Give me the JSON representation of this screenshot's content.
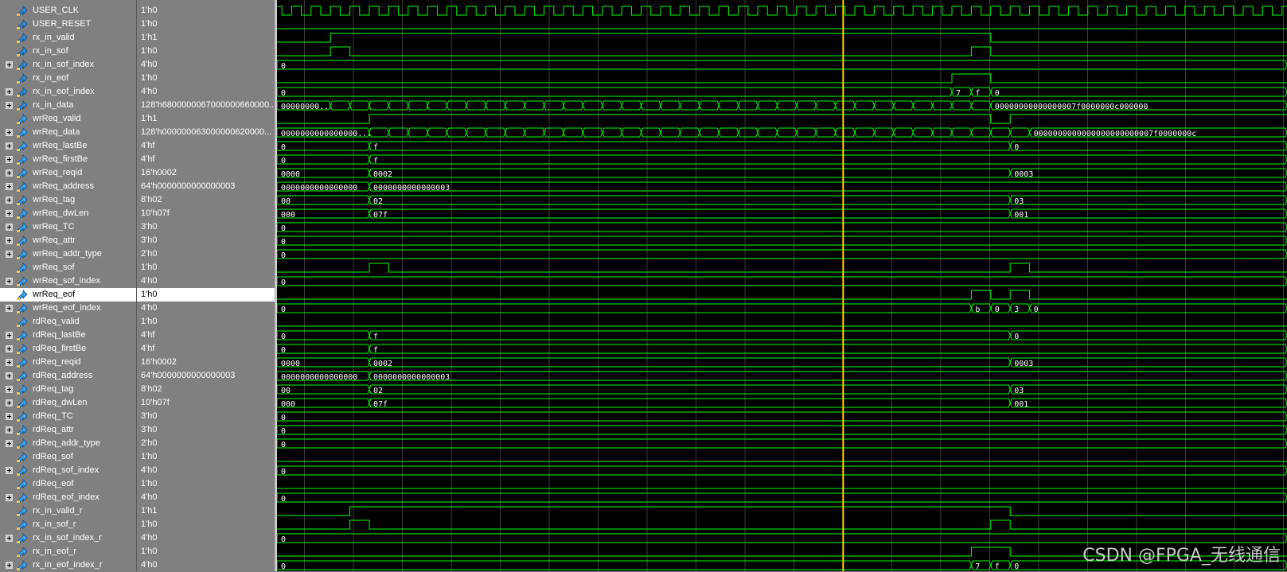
{
  "signals": [
    {
      "name": "USER_CLK",
      "value": "1'h0",
      "bus": false,
      "icon": "input-arrow-icon"
    },
    {
      "name": "USER_RESET",
      "value": "1'h0",
      "bus": false,
      "icon": "input-arrow-icon"
    },
    {
      "name": "rx_in_valid",
      "value": "1'h1",
      "bus": false,
      "icon": "input-arrow-icon"
    },
    {
      "name": "rx_in_sof",
      "value": "1'h0",
      "bus": false,
      "icon": "input-arrow-icon"
    },
    {
      "name": "rx_in_sof_index",
      "value": "4'h0",
      "bus": true,
      "icon": "input-arrow-icon"
    },
    {
      "name": "rx_in_eof",
      "value": "1'h0",
      "bus": false,
      "icon": "input-arrow-icon"
    },
    {
      "name": "rx_in_eof_index",
      "value": "4'h0",
      "bus": true,
      "icon": "input-arrow-icon"
    },
    {
      "name": "rx_in_data",
      "value": "128'h6800000067000000660000...",
      "bus": true,
      "icon": "input-arrow-icon"
    },
    {
      "name": "wrReq_valid",
      "value": "1'h1",
      "bus": false,
      "icon": "output-arrow-icon"
    },
    {
      "name": "wrReq_data",
      "value": "128'h000000063000000620000...",
      "bus": true,
      "icon": "output-arrow-icon"
    },
    {
      "name": "wrReq_lastBe",
      "value": "4'hf",
      "bus": true,
      "icon": "output-arrow-icon"
    },
    {
      "name": "wrReq_firstBe",
      "value": "4'hf",
      "bus": true,
      "icon": "output-arrow-icon"
    },
    {
      "name": "wrReq_reqid",
      "value": "16'h0002",
      "bus": true,
      "icon": "output-arrow-icon"
    },
    {
      "name": "wrReq_address",
      "value": "64'h0000000000000003",
      "bus": true,
      "icon": "output-arrow-icon"
    },
    {
      "name": "wrReq_tag",
      "value": "8'h02",
      "bus": true,
      "icon": "output-arrow-icon"
    },
    {
      "name": "wrReq_dwLen",
      "value": "10'h07f",
      "bus": true,
      "icon": "output-arrow-icon"
    },
    {
      "name": "wrReq_TC",
      "value": "3'h0",
      "bus": true,
      "icon": "output-arrow-icon"
    },
    {
      "name": "wrReq_attr",
      "value": "3'h0",
      "bus": true,
      "icon": "output-arrow-icon"
    },
    {
      "name": "wrReq_addr_type",
      "value": "2'h0",
      "bus": true,
      "icon": "output-arrow-icon"
    },
    {
      "name": "wrReq_sof",
      "value": "1'h0",
      "bus": false,
      "icon": "output-arrow-icon"
    },
    {
      "name": "wrReq_sof_index",
      "value": "4'h0",
      "bus": true,
      "icon": "output-arrow-icon"
    },
    {
      "name": "wrReq_eof",
      "value": "1'h0",
      "bus": false,
      "icon": "output-arrow-icon",
      "selected": true
    },
    {
      "name": "wrReq_eof_index",
      "value": "4'h0",
      "bus": true,
      "icon": "output-arrow-icon"
    },
    {
      "name": "rdReq_valid",
      "value": "1'h0",
      "bus": false,
      "icon": "output-arrow-icon"
    },
    {
      "name": "rdReq_lastBe",
      "value": "4'hf",
      "bus": true,
      "icon": "output-arrow-icon"
    },
    {
      "name": "rdReq_firstBe",
      "value": "4'hf",
      "bus": true,
      "icon": "output-arrow-icon"
    },
    {
      "name": "rdReq_reqid",
      "value": "16'h0002",
      "bus": true,
      "icon": "output-arrow-icon"
    },
    {
      "name": "rdReq_address",
      "value": "64'h0000000000000003",
      "bus": true,
      "icon": "output-arrow-icon"
    },
    {
      "name": "rdReq_tag",
      "value": "8'h02",
      "bus": true,
      "icon": "output-arrow-icon"
    },
    {
      "name": "rdReq_dwLen",
      "value": "10'h07f",
      "bus": true,
      "icon": "output-arrow-icon"
    },
    {
      "name": "rdReq_TC",
      "value": "3'h0",
      "bus": true,
      "icon": "output-arrow-icon"
    },
    {
      "name": "rdReq_attr",
      "value": "3'h0",
      "bus": true,
      "icon": "output-arrow-icon"
    },
    {
      "name": "rdReq_addr_type",
      "value": "2'h0",
      "bus": true,
      "icon": "output-arrow-icon"
    },
    {
      "name": "rdReq_sof",
      "value": "1'h0",
      "bus": false,
      "icon": "output-arrow-icon"
    },
    {
      "name": "rdReq_sof_index",
      "value": "4'h0",
      "bus": true,
      "icon": "output-arrow-icon"
    },
    {
      "name": "rdReq_eof",
      "value": "1'h0",
      "bus": false,
      "icon": "output-arrow-icon"
    },
    {
      "name": "rdReq_eof_index",
      "value": "4'h0",
      "bus": true,
      "icon": "output-arrow-icon"
    },
    {
      "name": "rx_in_valid_r",
      "value": "1'h1",
      "bus": false,
      "icon": "output-arrow-icon"
    },
    {
      "name": "rx_in_sof_r",
      "value": "1'h0",
      "bus": false,
      "icon": "output-arrow-icon"
    },
    {
      "name": "rx_in_sof_index_r",
      "value": "4'h0",
      "bus": true,
      "icon": "output-arrow-icon"
    },
    {
      "name": "rx_in_eof_r",
      "value": "1'h0",
      "bus": false,
      "icon": "output-arrow-icon"
    },
    {
      "name": "rx_in_eof_index_r",
      "value": "4'h0",
      "bus": true,
      "icon": "output-arrow-icon"
    }
  ],
  "waves": {
    "time_units": "clock cycles",
    "cursor_cycle": 29.4,
    "rows": [
      {
        "kind": "clock"
      },
      {
        "kind": "bit",
        "init": 0,
        "edges": []
      },
      {
        "kind": "bit",
        "init": 0,
        "edges": [
          3,
          37
        ]
      },
      {
        "kind": "bit",
        "init": 0,
        "edges": [
          3,
          4,
          36,
          37
        ]
      },
      {
        "kind": "bus",
        "segments": [
          [
            0,
            "0"
          ]
        ]
      },
      {
        "kind": "bit",
        "init": 0,
        "edges": [
          35,
          37
        ]
      },
      {
        "kind": "bus",
        "segments": [
          [
            0,
            "0"
          ],
          [
            35,
            "7"
          ],
          [
            36,
            "f"
          ],
          [
            37,
            "0"
          ]
        ]
      },
      {
        "kind": "bus",
        "segments": [
          [
            0,
            "00000000..."
          ],
          [
            3,
            ""
          ],
          [
            4,
            ""
          ],
          [
            5,
            ""
          ],
          [
            6,
            ""
          ],
          [
            7,
            ""
          ],
          [
            8,
            ""
          ],
          [
            9,
            ""
          ],
          [
            10,
            ""
          ],
          [
            11,
            ""
          ],
          [
            12,
            ""
          ],
          [
            13,
            ""
          ],
          [
            14,
            ""
          ],
          [
            15,
            ""
          ],
          [
            16,
            ""
          ],
          [
            17,
            ""
          ],
          [
            18,
            ""
          ],
          [
            19,
            ""
          ],
          [
            20,
            ""
          ],
          [
            21,
            ""
          ],
          [
            22,
            ""
          ],
          [
            23,
            ""
          ],
          [
            24,
            ""
          ],
          [
            25,
            ""
          ],
          [
            26,
            ""
          ],
          [
            27,
            ""
          ],
          [
            28,
            ""
          ],
          [
            29,
            ""
          ],
          [
            30,
            ""
          ],
          [
            31,
            ""
          ],
          [
            32,
            ""
          ],
          [
            33,
            ""
          ],
          [
            34,
            ""
          ],
          [
            35,
            ""
          ],
          [
            36,
            ""
          ],
          [
            37,
            "00000000000000007f0000000c000000"
          ]
        ]
      },
      {
        "kind": "bit",
        "init": 0,
        "edges": [
          5,
          37,
          38
        ]
      },
      {
        "kind": "bus",
        "segments": [
          [
            0,
            "0000000000000000..."
          ],
          [
            5,
            ""
          ],
          [
            6,
            ""
          ],
          [
            7,
            ""
          ],
          [
            8,
            ""
          ],
          [
            9,
            ""
          ],
          [
            10,
            ""
          ],
          [
            11,
            ""
          ],
          [
            12,
            ""
          ],
          [
            13,
            ""
          ],
          [
            14,
            ""
          ],
          [
            15,
            ""
          ],
          [
            16,
            ""
          ],
          [
            17,
            ""
          ],
          [
            18,
            ""
          ],
          [
            19,
            ""
          ],
          [
            20,
            ""
          ],
          [
            21,
            ""
          ],
          [
            22,
            ""
          ],
          [
            23,
            ""
          ],
          [
            24,
            ""
          ],
          [
            25,
            ""
          ],
          [
            26,
            ""
          ],
          [
            27,
            ""
          ],
          [
            28,
            ""
          ],
          [
            29,
            ""
          ],
          [
            30,
            ""
          ],
          [
            31,
            ""
          ],
          [
            32,
            ""
          ],
          [
            33,
            ""
          ],
          [
            34,
            ""
          ],
          [
            35,
            ""
          ],
          [
            36,
            ""
          ],
          [
            37,
            ""
          ],
          [
            38,
            ""
          ],
          [
            39,
            "0000000000000000000000007f0000000c"
          ]
        ]
      },
      {
        "kind": "bus",
        "segments": [
          [
            0,
            "0"
          ],
          [
            5,
            "f"
          ],
          [
            38,
            "0"
          ]
        ]
      },
      {
        "kind": "bus",
        "segments": [
          [
            0,
            "0"
          ],
          [
            5,
            "f"
          ]
        ]
      },
      {
        "kind": "bus",
        "segments": [
          [
            0,
            "0000"
          ],
          [
            5,
            "0002"
          ],
          [
            38,
            "0003"
          ]
        ]
      },
      {
        "kind": "bus",
        "segments": [
          [
            0,
            "0000000000000000"
          ],
          [
            5,
            "0000000000000003"
          ]
        ]
      },
      {
        "kind": "bus",
        "segments": [
          [
            0,
            "00"
          ],
          [
            5,
            "02"
          ],
          [
            38,
            "03"
          ]
        ]
      },
      {
        "kind": "bus",
        "segments": [
          [
            0,
            "000"
          ],
          [
            5,
            "07f"
          ],
          [
            38,
            "001"
          ]
        ]
      },
      {
        "kind": "bus",
        "segments": [
          [
            0,
            "0"
          ]
        ]
      },
      {
        "kind": "bus",
        "segments": [
          [
            0,
            "0"
          ]
        ]
      },
      {
        "kind": "bus",
        "segments": [
          [
            0,
            "0"
          ]
        ]
      },
      {
        "kind": "bit",
        "init": 0,
        "edges": [
          5,
          6,
          38,
          39
        ]
      },
      {
        "kind": "bus",
        "segments": [
          [
            0,
            "0"
          ]
        ]
      },
      {
        "kind": "bit",
        "init": 0,
        "edges": [
          36,
          37,
          38,
          39
        ]
      },
      {
        "kind": "bus",
        "segments": [
          [
            0,
            "0"
          ],
          [
            36,
            "b"
          ],
          [
            37,
            "0"
          ],
          [
            38,
            "3"
          ],
          [
            39,
            "0"
          ]
        ]
      },
      {
        "kind": "bit",
        "init": 0,
        "edges": []
      },
      {
        "kind": "bus",
        "segments": [
          [
            0,
            "0"
          ],
          [
            5,
            "f"
          ],
          [
            38,
            "0"
          ]
        ]
      },
      {
        "kind": "bus",
        "segments": [
          [
            0,
            "0"
          ],
          [
            5,
            "f"
          ]
        ]
      },
      {
        "kind": "bus",
        "segments": [
          [
            0,
            "0000"
          ],
          [
            5,
            "0002"
          ],
          [
            38,
            "0003"
          ]
        ]
      },
      {
        "kind": "bus",
        "segments": [
          [
            0,
            "0000000000000000"
          ],
          [
            5,
            "0000000000000003"
          ]
        ]
      },
      {
        "kind": "bus",
        "segments": [
          [
            0,
            "00"
          ],
          [
            5,
            "02"
          ],
          [
            38,
            "03"
          ]
        ]
      },
      {
        "kind": "bus",
        "segments": [
          [
            0,
            "000"
          ],
          [
            5,
            "07f"
          ],
          [
            38,
            "001"
          ]
        ]
      },
      {
        "kind": "bus",
        "segments": [
          [
            0,
            "0"
          ]
        ]
      },
      {
        "kind": "bus",
        "segments": [
          [
            0,
            "0"
          ]
        ]
      },
      {
        "kind": "bus",
        "segments": [
          [
            0,
            "0"
          ]
        ]
      },
      {
        "kind": "bit",
        "init": 0,
        "edges": []
      },
      {
        "kind": "bus",
        "segments": [
          [
            0,
            "0"
          ]
        ]
      },
      {
        "kind": "bit",
        "init": 0,
        "edges": []
      },
      {
        "kind": "bus",
        "segments": [
          [
            0,
            "0"
          ]
        ]
      },
      {
        "kind": "bit",
        "init": 0,
        "edges": [
          4,
          38
        ]
      },
      {
        "kind": "bit",
        "init": 0,
        "edges": [
          4,
          5,
          37,
          38
        ]
      },
      {
        "kind": "bus",
        "segments": [
          [
            0,
            "0"
          ]
        ]
      },
      {
        "kind": "bit",
        "init": 0,
        "edges": [
          36,
          38
        ]
      },
      {
        "kind": "bus",
        "segments": [
          [
            0,
            "0"
          ],
          [
            36,
            "7"
          ],
          [
            37,
            "f"
          ],
          [
            38,
            "0"
          ]
        ]
      }
    ]
  },
  "colors": {
    "wave": "#00ff00",
    "cursor": "#ffd700",
    "grid": "#3c3c3c",
    "bus_text": "#ffffff",
    "background": "#000000"
  },
  "watermark": "CSDN @FPGA_无线通信"
}
